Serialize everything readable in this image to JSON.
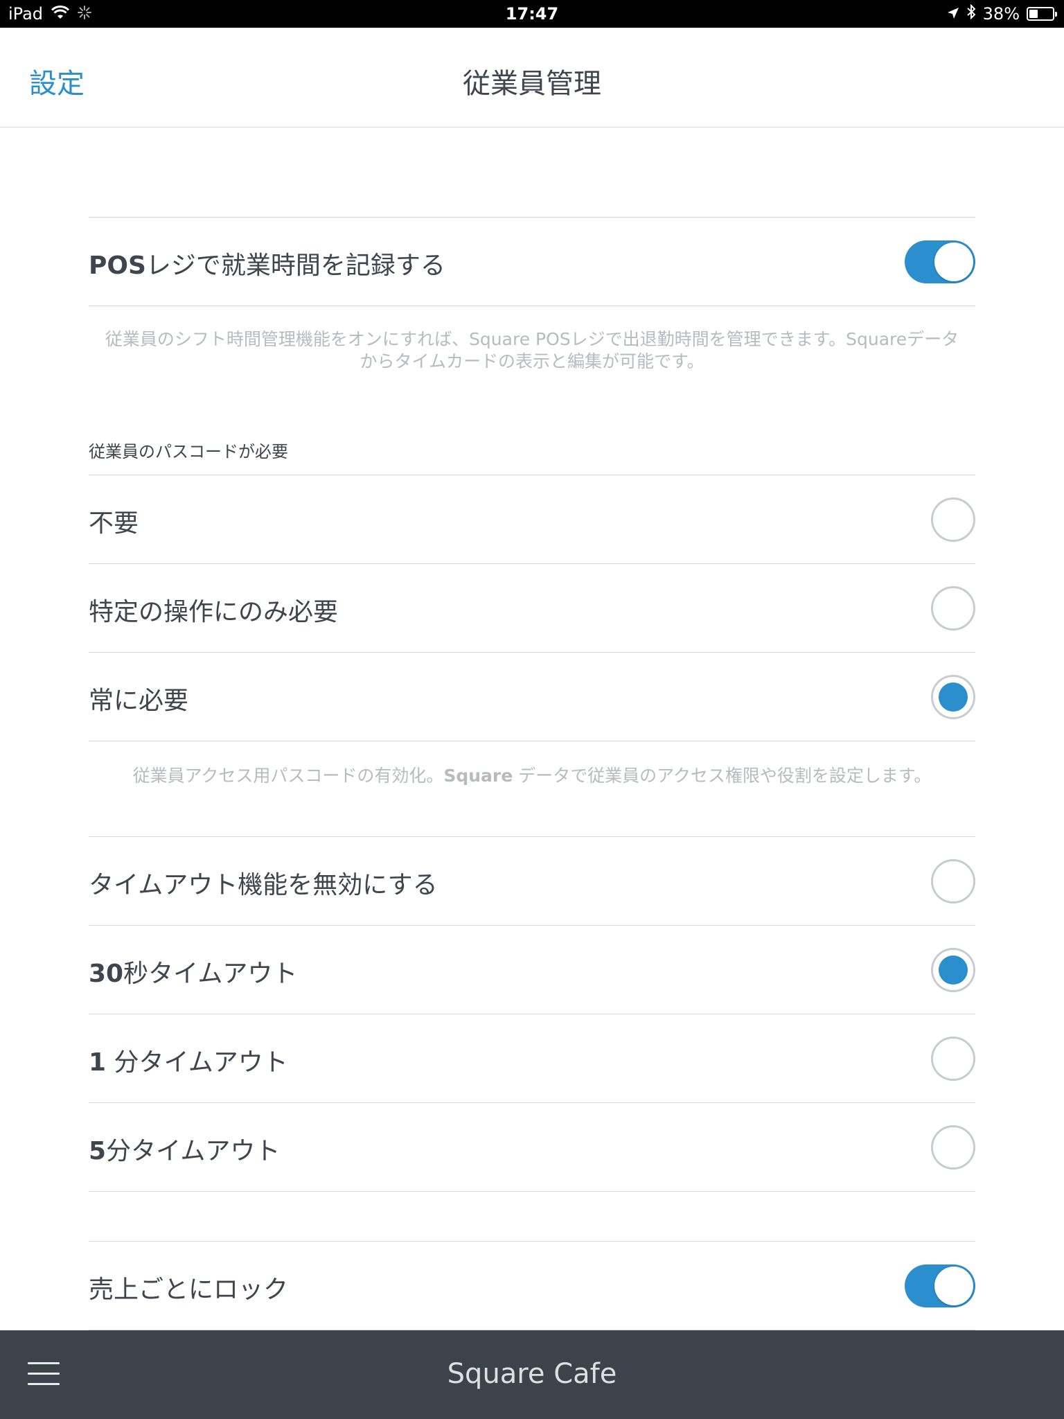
{
  "status_bar": {
    "device": "iPad",
    "time": "17:47",
    "battery_percent": "38%",
    "battery_level": 0.38
  },
  "nav": {
    "back_label": "設定",
    "title": "従業員管理"
  },
  "time_tracking": {
    "label_bold": "POS",
    "label_rest": "レジで就業時間を記録する",
    "enabled": true,
    "help_line1": "従業員のシフト時間管理機能をオンにすれば、Square POSレジで出退勤時間を管理できます。Squareデータ",
    "help_line2": "からタイムカードの表示と編集が可能です。"
  },
  "passcode": {
    "header": "従業員のパスコードが必要",
    "options": [
      {
        "label": "不要",
        "selected": false
      },
      {
        "label": "特定の操作にのみ必要",
        "selected": false
      },
      {
        "label": "常に必要",
        "selected": true
      }
    ],
    "help_pre": "従業員アクセス用パスコードの有効化。",
    "help_bold": "Square",
    "help_post": " データで従業員のアクセス権限や役割を設定します。"
  },
  "timeout": {
    "options": [
      {
        "bold": "",
        "rest": "タイムアウト機能を無効にする",
        "selected": false
      },
      {
        "bold": "30",
        "rest": "秒タイムアウト",
        "selected": true
      },
      {
        "bold": "1",
        "rest": " 分タイムアウト",
        "selected": false
      },
      {
        "bold": "5",
        "rest": "分タイムアウト",
        "selected": false
      }
    ]
  },
  "lock_after_sale": {
    "label": "売上ごとにロック",
    "enabled": true
  },
  "bottom_bar": {
    "title": "Square Cafe"
  },
  "colors": {
    "accent": "#2b8fce",
    "text": "#3e454d",
    "help_text": "#b7bbc0",
    "divider": "#d6d8db",
    "bottom_bar": "#3d434b"
  }
}
